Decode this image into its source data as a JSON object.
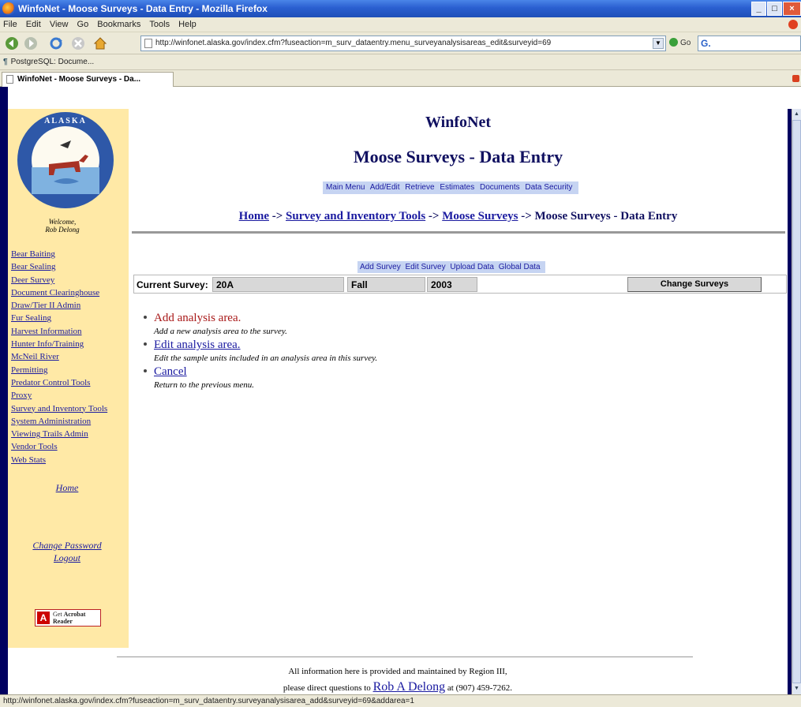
{
  "window": {
    "title": "WinfoNet - Moose Surveys - Data Entry - Mozilla Firefox",
    "minimize": "_",
    "restore": "□",
    "close": "×"
  },
  "menubar": [
    "File",
    "Edit",
    "View",
    "Go",
    "Bookmarks",
    "Tools",
    "Help"
  ],
  "toolbar": {
    "url": "http://winfonet.alaska.gov/index.cfm?fuseaction=m_surv_dataentry.menu_surveyanalysisareas_edit&surveyid=69",
    "go_label": "Go",
    "search_logo": "G."
  },
  "bookmarks": {
    "item": "PostgreSQL: Docume..."
  },
  "tab": {
    "label": "WinfoNet - Moose Surveys - Da..."
  },
  "sidebar": {
    "logo_text": "ALASKA",
    "welcome": "Welcome,",
    "user": "Rob Delong",
    "links": [
      "Bear Baiting",
      "Bear Sealing",
      "Deer Survey",
      "Document Clearinghouse",
      "Draw/Tier II Admin",
      "Fur Sealing",
      "Harvest Information",
      "Hunter Info/Training",
      "McNeil River",
      "Permitting",
      "Predator Control Tools",
      "Proxy",
      "Survey and Inventory Tools",
      "System Administration",
      "Viewing Trails Admin",
      "Vendor Tools",
      "Web Stats"
    ],
    "home": "Home",
    "change_password": "Change Password",
    "logout": "Logout",
    "acrobat": {
      "get": "Get",
      "line1": "Acrobat",
      "line2": "Reader"
    }
  },
  "header": {
    "site_title": "WinfoNet",
    "page_title": "Moose Surveys - Data Entry",
    "topnav": [
      "Main Menu",
      "Add/Edit",
      "Retrieve",
      "Estimates",
      "Documents",
      "Data Security"
    ],
    "breadcrumb": {
      "home": "Home",
      "sep1": " -> ",
      "survey_tools": "Survey and Inventory Tools",
      "sep2": " -> ",
      "moose": "Moose Surveys",
      "sep3": " -> ",
      "current": "Moose Surveys - Data Entry"
    }
  },
  "subnav": [
    "Add Survey",
    "Edit Survey",
    "Upload Data",
    "Global Data"
  ],
  "current_survey": {
    "label": "Current Survey:",
    "unit": "20A",
    "season": "Fall",
    "year": "2003",
    "change_button": "Change Surveys"
  },
  "menu": [
    {
      "link": "Add analysis area.",
      "desc": "Add a new analysis area to the survey."
    },
    {
      "link": "Edit analysis area.",
      "desc": "Edit the sample units included in an analysis area in this survey."
    },
    {
      "link": "Cancel",
      "desc": "Return to the previous menu."
    }
  ],
  "footer": {
    "line1": "All information here is provided and maintained by Region III,",
    "line2_pre": "please direct questions to",
    "contact": "Rob A Delong",
    "line2_post": "at (907) 459-7262."
  },
  "statusbar": {
    "text": "http://winfonet.alaska.gov/index.cfm?fuseaction=m_surv_dataentry.surveyanalysisarea_add&surveyid=69&addarea=1"
  }
}
